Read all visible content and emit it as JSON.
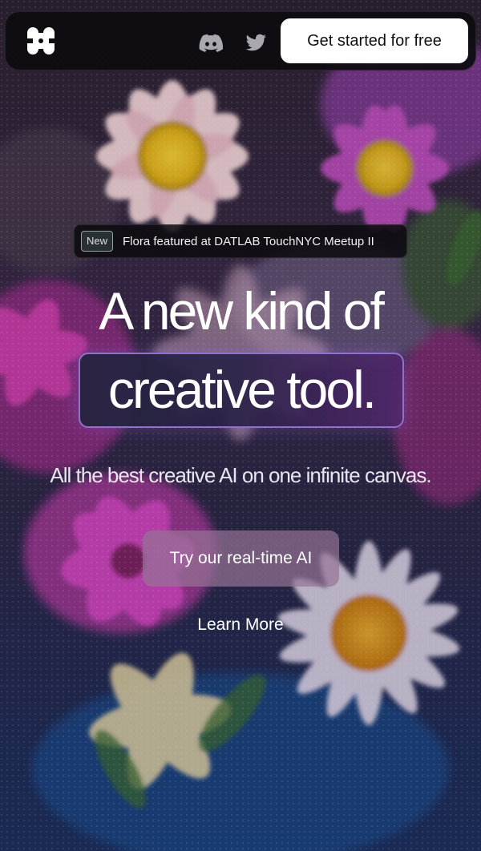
{
  "nav": {
    "logo_icon": "flower-logo-icon",
    "discord_icon": "discord-icon",
    "twitter_icon": "twitter-icon",
    "cta_label": "Get started for free"
  },
  "badge": {
    "tag": "New",
    "text": "Flora featured at DATLAB TouchNYC Meetup II"
  },
  "hero": {
    "line1": "A new kind of",
    "line2": "creative tool.",
    "subtitle": "All the best creative AI on one infinite canvas."
  },
  "actions": {
    "primary_label": "Try our real-time AI",
    "secondary_label": "Learn More"
  },
  "colors": {
    "nav_background": "#0e0c10",
    "cta_background": "#ffffff",
    "highlight_border": "#8e72cc",
    "primary_button": "#96739a"
  }
}
